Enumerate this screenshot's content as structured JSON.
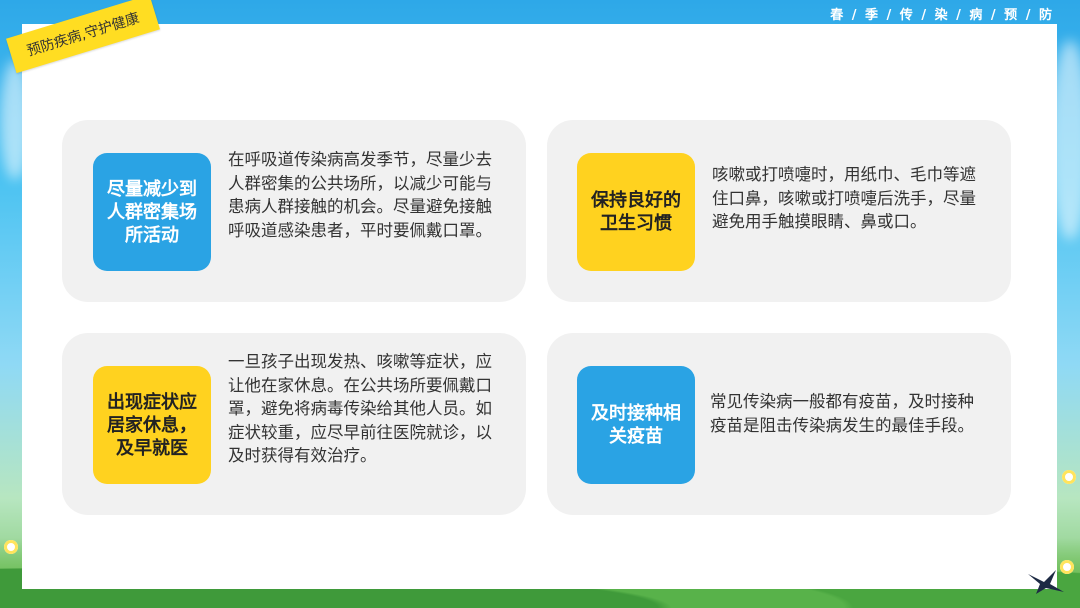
{
  "header": {
    "title": "春 / 季 / 传 / 染 / 病 / 预 / 防"
  },
  "badge": {
    "label": "预防疾病,守护健康"
  },
  "cards": [
    {
      "tag": "尽量减少到人群密集场所活动",
      "tag_color": "#2aa3e4",
      "text": "在呼吸道传染病高发季节，尽量少去人群密集的公共场所，以减少可能与患病人群接触的机会。尽量避免接触呼吸道感染患者，平时要佩戴口罩。"
    },
    {
      "tag": "保持良好的卫生习惯",
      "tag_color": "#ffd21f",
      "text": "咳嗽或打喷嚏时，用纸巾、毛巾等遮住口鼻，咳嗽或打喷嚏后洗手，尽量避免用手触摸眼睛、鼻或口。"
    },
    {
      "tag": "出现症状应居家休息，及早就医",
      "tag_color": "#ffd21f",
      "text": "一旦孩子出现发热、咳嗽等症状，应让他在家休息。在公共场所要佩戴口罩，避免将病毒传染给其他人员。如症状较重，应尽早前往医院就诊，以及时获得有效治疗。"
    },
    {
      "tag": "及时接种相关疫苗",
      "tag_color": "#2aa3e4",
      "text": "常见传染病一般都有疫苗，及时接种疫苗是阻击传染病发生的最佳手段。"
    }
  ]
}
